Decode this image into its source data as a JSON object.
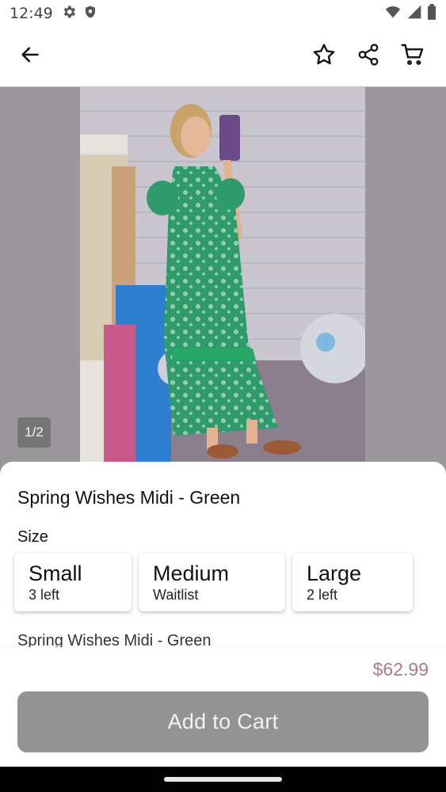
{
  "status_bar": {
    "time": "12:49",
    "left_icons": [
      "gear-icon",
      "shield-icon"
    ],
    "right_icons": [
      "wifi-icon",
      "signal-icon",
      "battery-icon"
    ]
  },
  "app_bar": {
    "icons": [
      "back-arrow-icon",
      "star-icon",
      "share-icon",
      "cart-icon"
    ]
  },
  "gallery": {
    "counter": "1/2"
  },
  "product": {
    "title": "Spring Wishes Midi - Green",
    "size_label": "Size",
    "sizes": [
      {
        "name": "Small",
        "availability": "3 left"
      },
      {
        "name": "Medium",
        "availability": "Waitlist"
      },
      {
        "name": "Large",
        "availability": "2 left"
      }
    ],
    "description": "Spring Wishes Midi - Green",
    "price": "$62.99"
  },
  "actions": {
    "add_to_cart_label": "Add to Cart"
  },
  "colors": {
    "price": "#b07a86",
    "button_disabled": "#949393",
    "image_backdrop": "#9a989b",
    "dress_green": "#2f9a6a"
  }
}
